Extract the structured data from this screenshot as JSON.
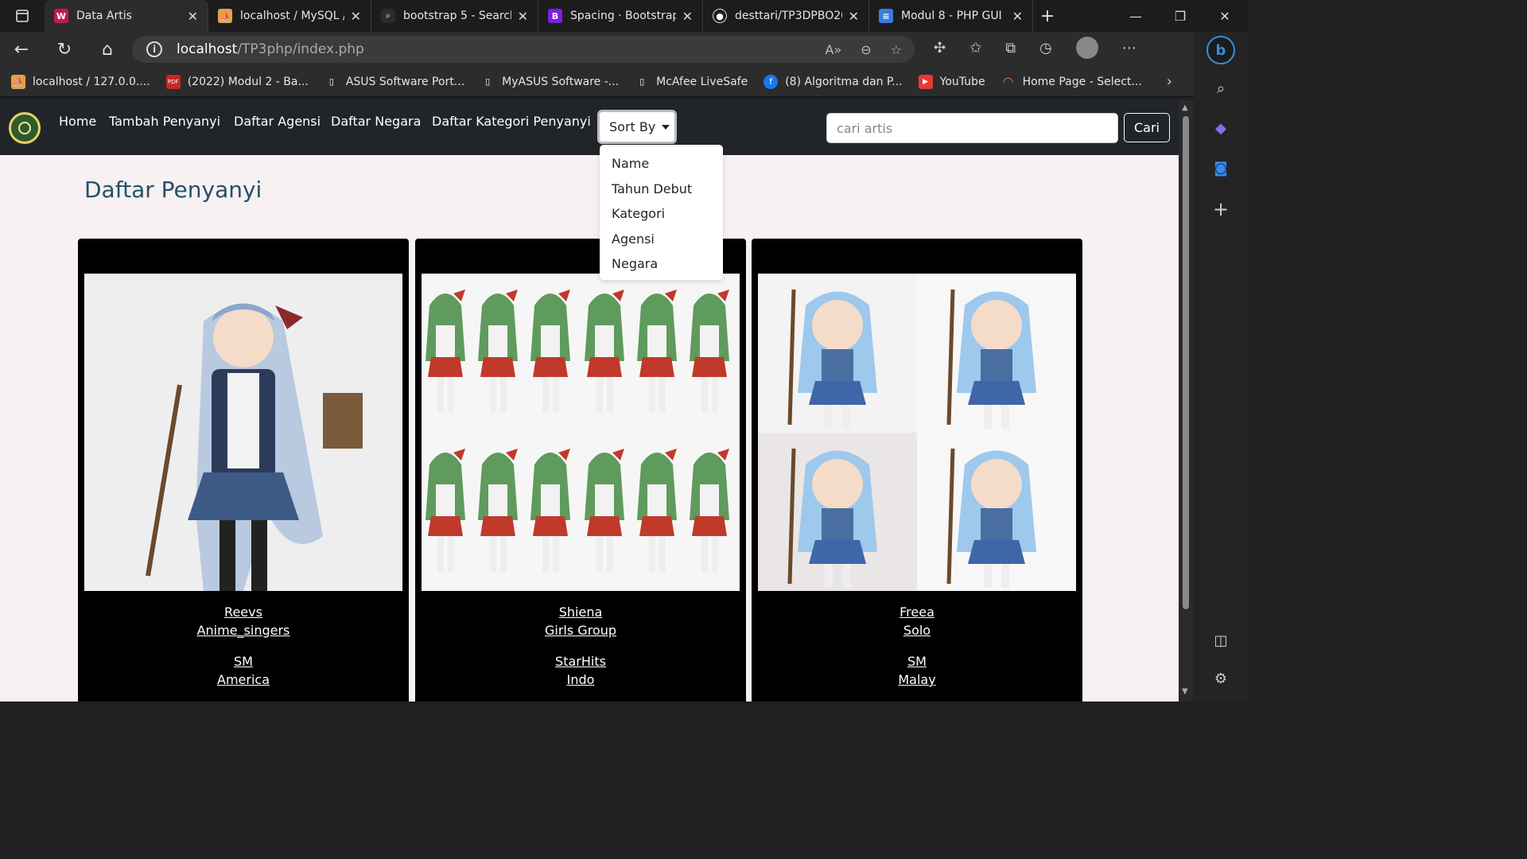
{
  "browser": {
    "tabs": [
      {
        "title": "Data Artis",
        "fav_color": "#c2185b",
        "fav_glyph": "W",
        "active": true
      },
      {
        "title": "localhost / MySQL /",
        "fav_color": "#e6a04a",
        "fav_glyph": "⛵",
        "active": false
      },
      {
        "title": "bootstrap 5 - Search",
        "fav_color": "#2c2c2c",
        "fav_glyph": "⌕",
        "active": false
      },
      {
        "title": "Spacing · Bootstrap",
        "fav_color": "#7b1fe0",
        "fav_glyph": "B",
        "active": false
      },
      {
        "title": "desttari/TP3DPBO20",
        "fav_color": "#1c1c1c",
        "fav_glyph": "●",
        "active": false
      },
      {
        "title": "Modul 8 - PHP GUI",
        "fav_color": "#3a7be0",
        "fav_glyph": "≡",
        "active": false
      }
    ],
    "url_host": "localhost",
    "url_path": "/TP3php/index.php",
    "bookmarks": [
      {
        "label": "localhost / 127.0.0....",
        "color": "#e6a04a",
        "glyph": "⛵"
      },
      {
        "label": "(2022) Modul 2 - Ba...",
        "color": "#c62828",
        "glyph": "PDF"
      },
      {
        "label": "ASUS Software Port...",
        "color": "#2c2c2c",
        "glyph": "▯"
      },
      {
        "label": "MyASUS Software -...",
        "color": "#2c2c2c",
        "glyph": "▯"
      },
      {
        "label": "McAfee LiveSafe",
        "color": "#2c2c2c",
        "glyph": "▯"
      },
      {
        "label": "(8) Algoritma dan P...",
        "color": "#1877f2",
        "glyph": "f"
      },
      {
        "label": "YouTube",
        "color": "#e53935",
        "glyph": "▶"
      },
      {
        "label": "Home Page - Select...",
        "color": "#2c2c2c",
        "glyph": "◠"
      }
    ]
  },
  "site": {
    "nav": [
      "Home",
      "Tambah Penyanyi",
      "Daftar Agensi",
      "Daftar Negara",
      "Daftar Kategori Penyanyi"
    ],
    "sort_label": "Sort By",
    "sort_options": [
      "Name",
      "Tahun Debut",
      "Kategori",
      "Agensi",
      "Negara"
    ],
    "search_placeholder": "cari artis",
    "search_button": "Cari",
    "heading": "Daftar Penyanyi"
  },
  "artists": [
    {
      "name": "Reevs",
      "category": "Anime_singers",
      "agency": "SM",
      "country": "America"
    },
    {
      "name": "Shiena",
      "category": "Girls Group",
      "agency": "StarHits",
      "country": "Indo"
    },
    {
      "name": "Freea",
      "category": "Solo",
      "agency": "SM",
      "country": "Malay"
    }
  ]
}
